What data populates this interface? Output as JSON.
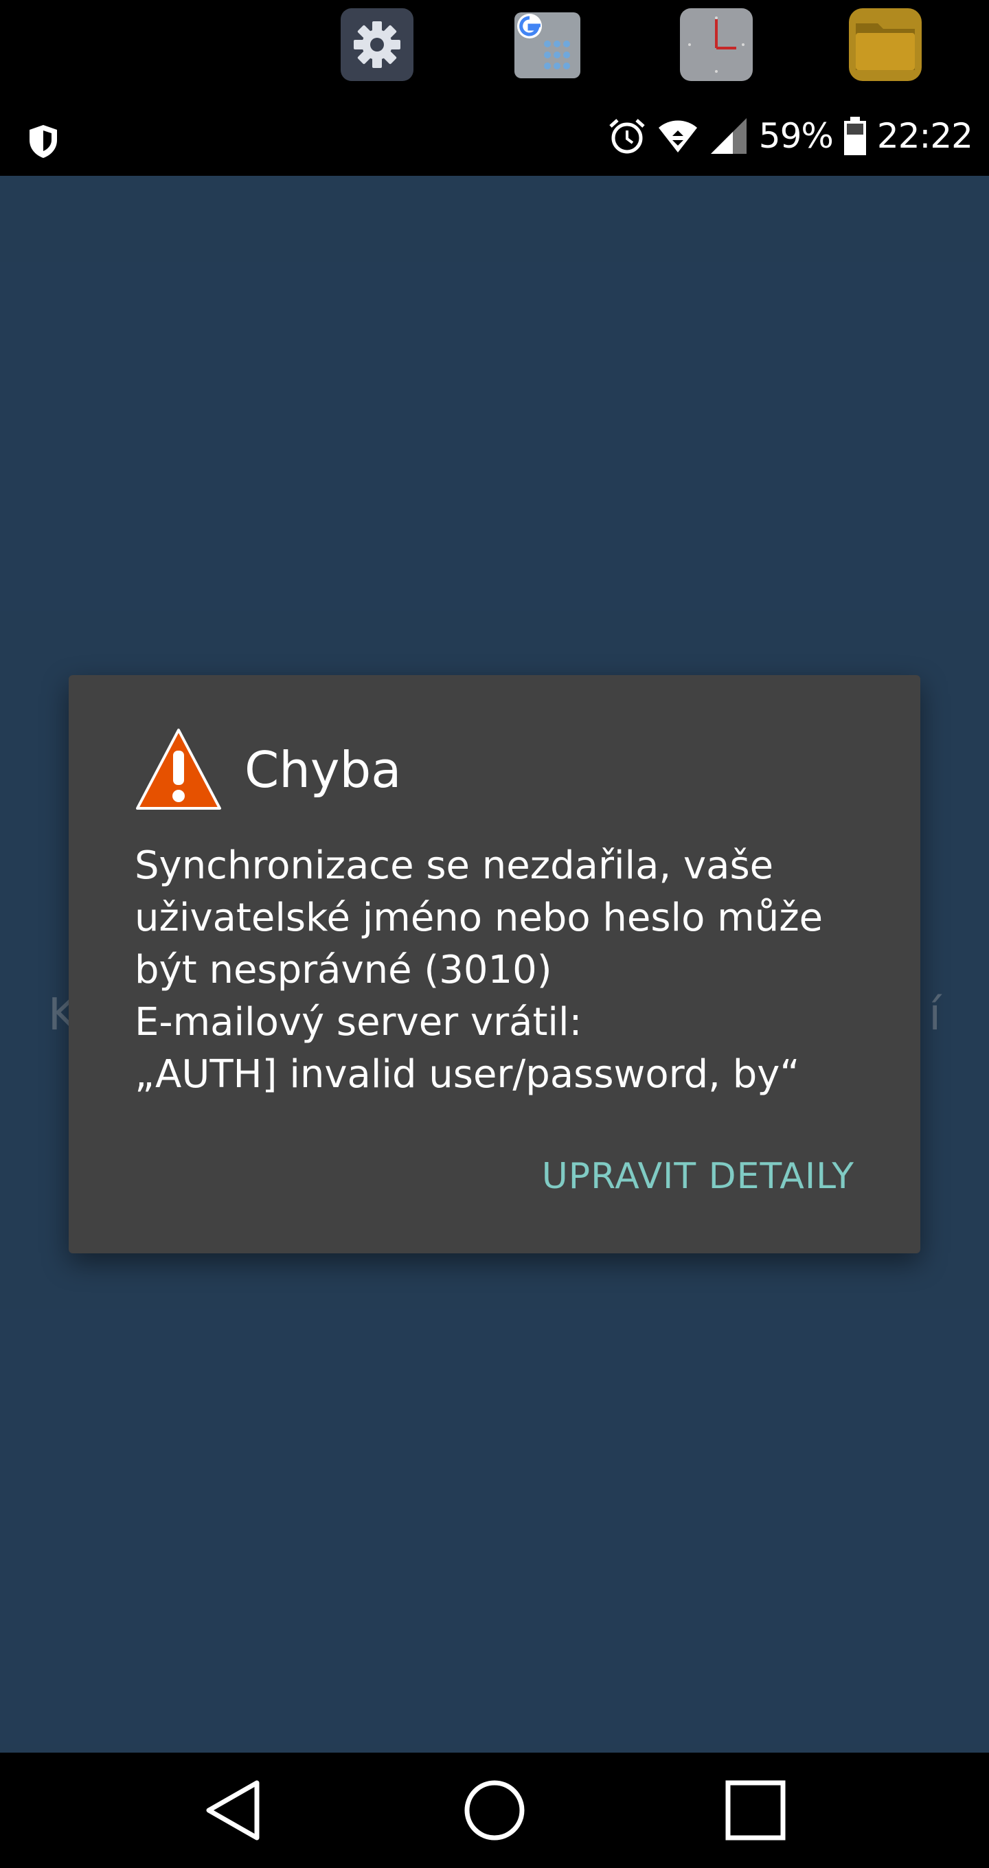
{
  "status_bar": {
    "battery_percent": "59%",
    "time": "22:22",
    "icons": [
      "shield-icon",
      "alarm-icon",
      "wifi-icon",
      "signal-icon",
      "battery-icon"
    ]
  },
  "top_apps": [
    "settings-app-icon",
    "gboard-app-icon",
    "clock-app-icon",
    "files-app-icon"
  ],
  "background": {
    "partial_text_left": "K",
    "partial_text_right": "í"
  },
  "dialog": {
    "title": "Chyba",
    "message_line1": "Synchronizace se nezdařila, vaše",
    "message_line2": "uživatelské jméno nebo heslo může",
    "message_line3": "být nesprávné (3010)",
    "message_line4": "E-mailový server vrátil:",
    "message_line5": "„AUTH] invalid user/password, by“",
    "action_label": "UPRAVIT DETAILY",
    "icon": "warning-icon",
    "accent_color": "#80cbc4",
    "warning_color": "#e65100"
  },
  "nav_bar": {
    "buttons": [
      "back",
      "home",
      "recents"
    ]
  }
}
